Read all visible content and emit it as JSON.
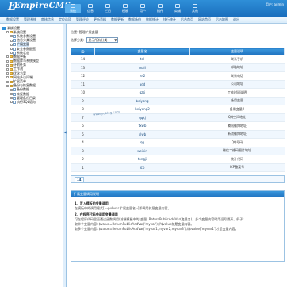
{
  "app": {
    "logo": "EmpireCMS",
    "user": "用户: admin"
  },
  "top_nav": [
    {
      "label": "系统"
    },
    {
      "label": "信息"
    },
    {
      "label": "栏目"
    },
    {
      "label": "模板"
    },
    {
      "label": "用户"
    },
    {
      "label": "插件"
    },
    {
      "label": "商城"
    },
    {
      "label": "其他"
    }
  ],
  "sub_nav": [
    "数据设置",
    "管理系统",
    "审核信息",
    "定位选项",
    "管理评论",
    "更新资料",
    "数据更新",
    "数据备份",
    "数据统计",
    "排行统计",
    "后台首页",
    "网站首页",
    "后台地图",
    "退出"
  ],
  "sidebar": {
    "items": [
      {
        "label": "系统设置",
        "type": "root"
      },
      {
        "label": "系统设置",
        "type": "folder",
        "indent": 1
      },
      {
        "label": "系统参数设置",
        "type": "doc",
        "indent": 2
      },
      {
        "label": "信息分类设置",
        "type": "doc",
        "indent": 2
      },
      {
        "label": "扩展变量",
        "type": "doc",
        "indent": 2,
        "selected": true
      },
      {
        "label": "安全参数配置",
        "type": "doc",
        "indent": 2
      },
      {
        "label": "系统状态",
        "type": "doc",
        "indent": 2
      },
      {
        "label": "数据更新",
        "type": "folder",
        "indent": 1
      },
      {
        "label": "数据库与系统模型",
        "type": "folder",
        "indent": 1
      },
      {
        "label": "计划任务",
        "type": "folder",
        "indent": 1
      },
      {
        "label": "工作流",
        "type": "folder",
        "indent": 1
      },
      {
        "label": "优化方案",
        "type": "folder",
        "indent": 1
      },
      {
        "label": "网站多访问端",
        "type": "folder",
        "indent": 1
      },
      {
        "label": "扩展菜单",
        "type": "folder",
        "indent": 1
      },
      {
        "label": "备份与恢复数据",
        "type": "folder",
        "indent": 1
      },
      {
        "label": "备份数据",
        "type": "doc",
        "indent": 2
      },
      {
        "label": "恢复数据",
        "type": "doc",
        "indent": 2
      },
      {
        "label": "管理备份目录",
        "type": "doc",
        "indent": 2
      },
      {
        "label": "执行SQL语句",
        "type": "doc",
        "indent": 2
      }
    ]
  },
  "main": {
    "breadcrumb": "位置: 管理扩展变量",
    "filter_label": "选择分类:",
    "filter_value": "显示所有分类",
    "table": {
      "columns": [
        "ID",
        "变量名",
        "变量说明"
      ],
      "rows": [
        [
          "14",
          "tel",
          "联系手机"
        ],
        [
          "13",
          "mail",
          "邮箱地址"
        ],
        [
          "12",
          "tel2",
          "联系电话"
        ],
        [
          "11",
          "add",
          "公司地址"
        ],
        [
          "10",
          "gzsj",
          "工作时间说明"
        ],
        [
          "9",
          "beiyong",
          "备用变量"
        ],
        [
          "8",
          "beiyong2",
          "备用变量2"
        ],
        [
          "7",
          "qqkj",
          "QQ空间地址"
        ],
        [
          "6",
          "txwb",
          "腾讯微博地址"
        ],
        [
          "5",
          "xlwb",
          "新浪微博地址"
        ],
        [
          "4",
          "qq",
          "QQ号码"
        ],
        [
          "3",
          "weixin",
          "微信二维码图片地址"
        ],
        [
          "2",
          "tongji",
          "统计代码"
        ],
        [
          "1",
          "icp",
          "ICP备案号"
        ]
      ]
    },
    "pager": "14",
    "help": {
      "title": "扩展变量调用说明",
      "h1": "1、写入模板的变量调用",
      "p1": "在模板中的调用格式[!--pubvar.扩展变量名--]即调用扩展变量内容。",
      "h2": "2、在程序代码中调用变量调用",
      "p2": "可在程序代码里面通过函数调用(前端模板中的)变量: ReturnPublicAddVar(变量名)，多个变量内容时用逗号隔开，例子:",
      "p3": "取单个变量内容: $value=ReturnPublicAddVar('myvar');//$value就是变量内容。",
      "p4": "取多个变量内容: $value=ReturnPublicAddVar('myvar1,myvar2,myvar3');//$value['myvar1']才是变量内容。"
    }
  },
  "watermark": "www.yublog.com"
}
